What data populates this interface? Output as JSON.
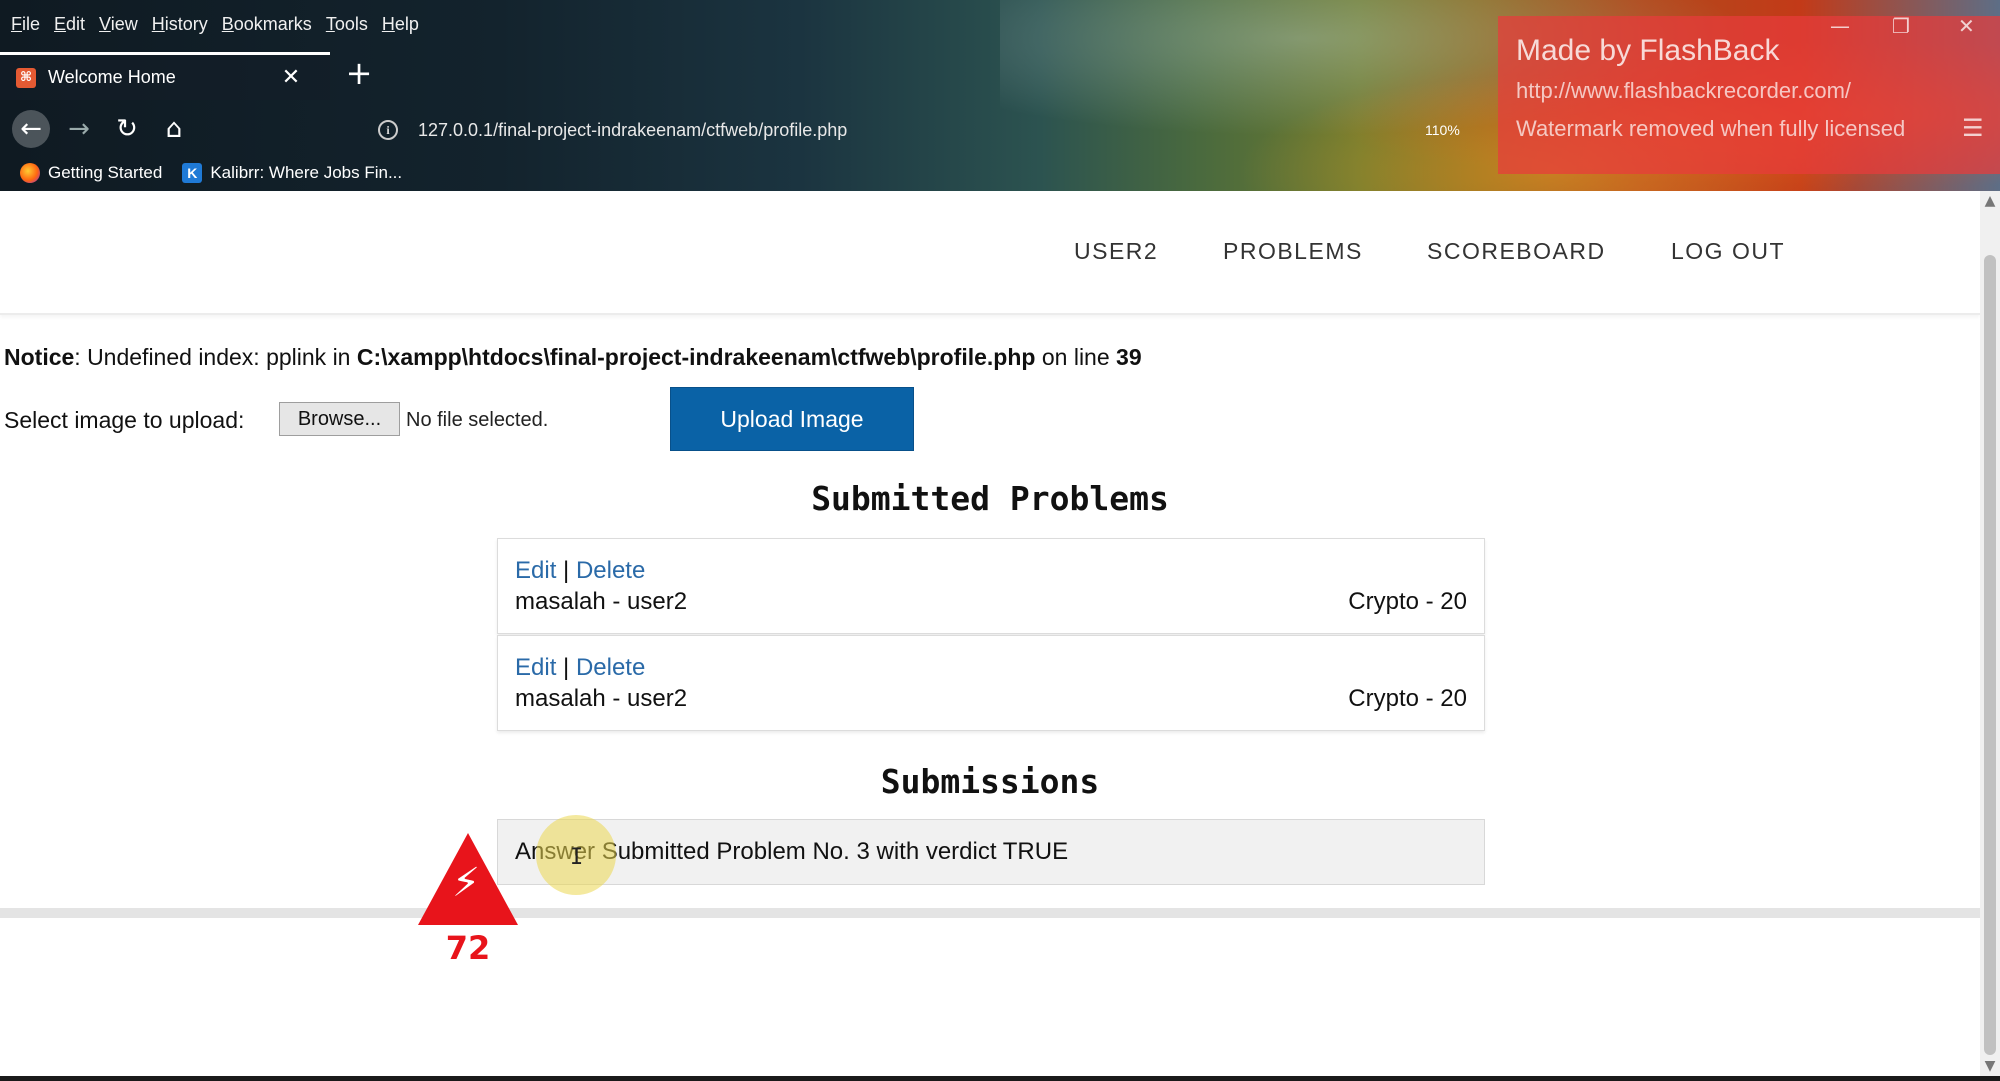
{
  "menubar": [
    "File",
    "Edit",
    "View",
    "History",
    "Bookmarks",
    "Tools",
    "Help"
  ],
  "tab": {
    "title": "Welcome Home",
    "close": "✕",
    "new_tab": "+"
  },
  "navigation": {
    "url": "127.0.0.1/final-project-indrakeenam/ctfweb/profile.php",
    "zoom": "110%"
  },
  "bookmarks": [
    {
      "label": "Getting Started",
      "icon": "firefox-icon"
    },
    {
      "label": "Kalibrr: Where Jobs Fin...",
      "icon": "k-icon",
      "icon_letter": "K"
    }
  ],
  "watermark": {
    "line1": "Made by FlashBack",
    "line2": "http://www.flashbackrecorder.com/",
    "line3": "Watermark removed when fully licensed"
  },
  "site_nav": {
    "user": "USER2",
    "problems": "PROBLEMS",
    "scoreboard": "SCOREBOARD",
    "logout": "LOG OUT"
  },
  "notice": {
    "label": "Notice",
    "message": ": Undefined index: pplink in ",
    "path": "C:\\xampp\\htdocs\\final-project-indrakeenam\\ctfweb\\profile.php",
    "on_line": " on line ",
    "line": "39"
  },
  "upload": {
    "label": "Select image to upload:",
    "browse": "Browse...",
    "file_status": "No file selected.",
    "button": "Upload Image"
  },
  "submitted_problems": {
    "title": "Submitted Problems",
    "items": [
      {
        "edit": "Edit",
        "separator": " | ",
        "delete": "Delete",
        "name": "masalah - user2",
        "category": "Crypto - 20"
      },
      {
        "edit": "Edit",
        "separator": " | ",
        "delete": "Delete",
        "name": "masalah - user2",
        "category": "Crypto - 20"
      }
    ]
  },
  "submissions": {
    "title": "Submissions",
    "items": [
      "Answer Submitted Problem No. 3 with verdict TRUE"
    ]
  },
  "recorder_badge": {
    "count": "72"
  },
  "colors": {
    "upload_button": "#0a62a6",
    "link": "#2a6aa8",
    "watermark": "#e83c3c",
    "badge": "#e8141b"
  }
}
